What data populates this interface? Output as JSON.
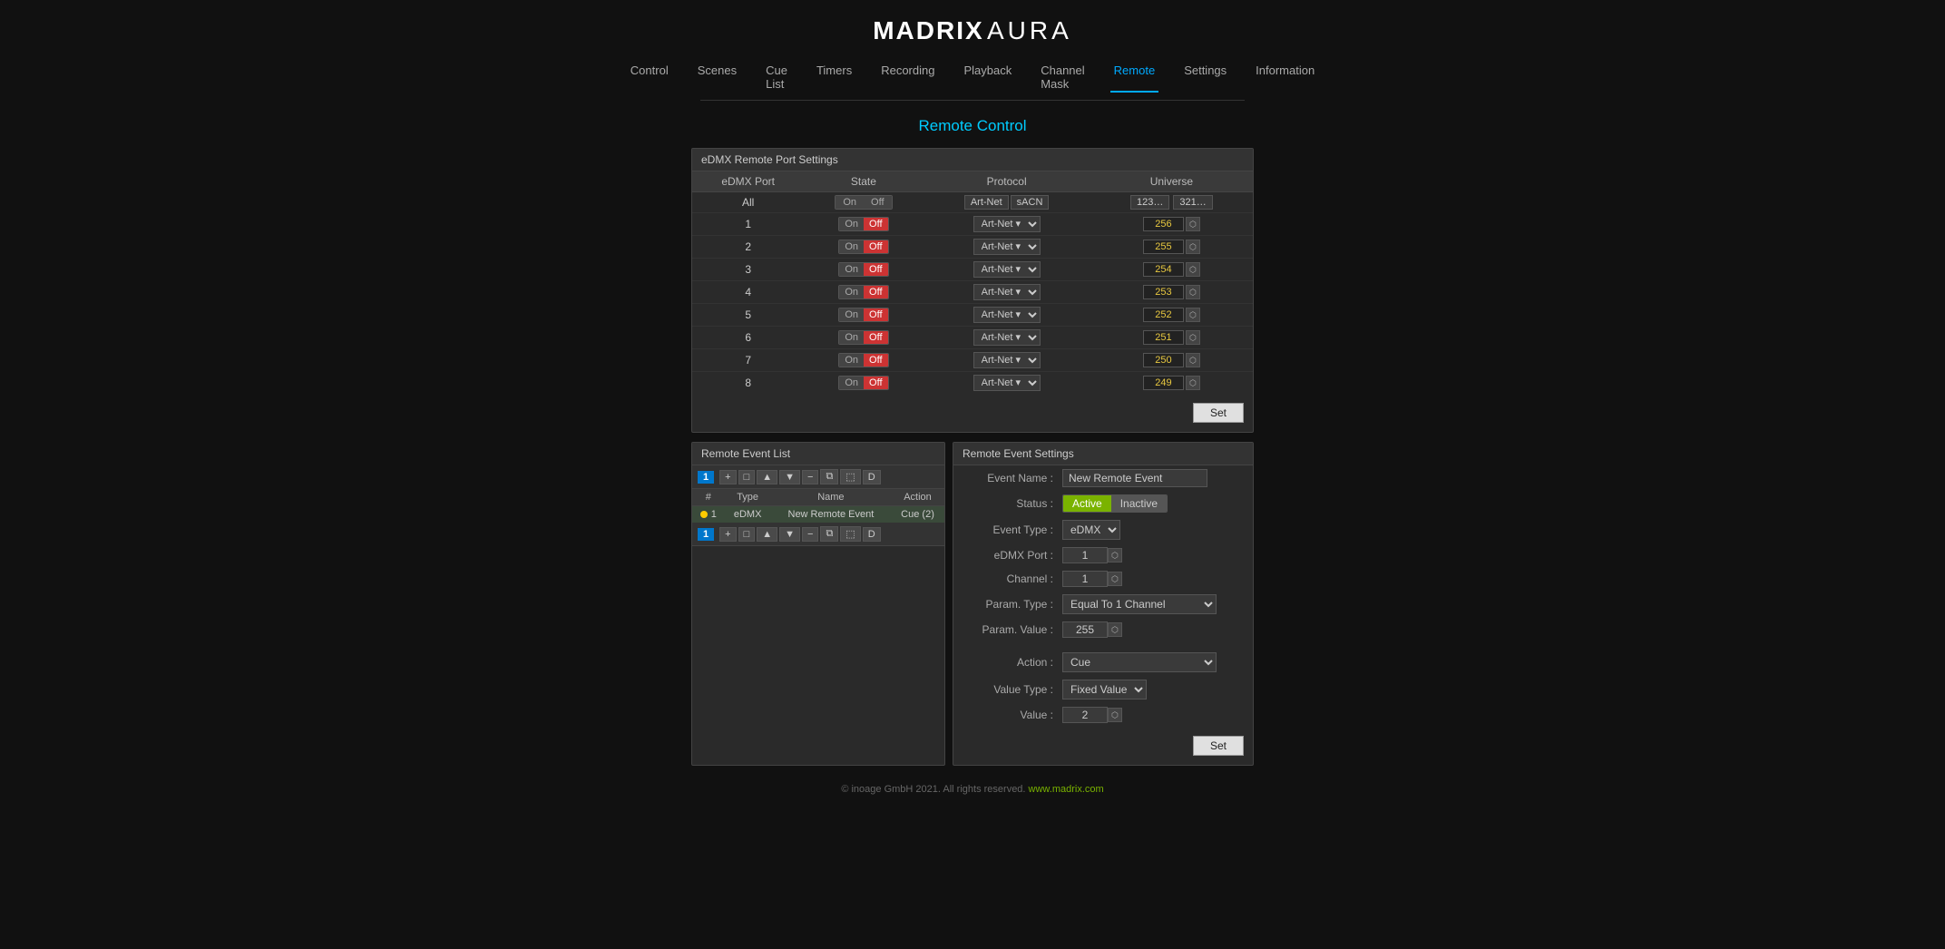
{
  "app": {
    "logo_bold": "MADRIX",
    "logo_light": "AURA",
    "footer_text": "© inoage GmbH 2021. All rights reserved.",
    "footer_link": "www.madrix.com"
  },
  "nav": {
    "items": [
      {
        "label": "Control",
        "active": false
      },
      {
        "label": "Scenes",
        "active": false
      },
      {
        "label": "Cue List",
        "active": false
      },
      {
        "label": "Timers",
        "active": false
      },
      {
        "label": "Recording",
        "active": false
      },
      {
        "label": "Playback",
        "active": false
      },
      {
        "label": "Channel Mask",
        "active": false
      },
      {
        "label": "Remote",
        "active": true
      },
      {
        "label": "Settings",
        "active": false
      },
      {
        "label": "Information",
        "active": false
      }
    ]
  },
  "page_title": "Remote Control",
  "edMXSection": {
    "title": "eDMX Remote Port Settings",
    "columns": [
      "eDMX Port",
      "State",
      "Protocol",
      "Universe"
    ],
    "all_row": {
      "port": "All",
      "on_label": "On",
      "off_label": "Off",
      "proto1": "Art-Net",
      "proto2": "sACN",
      "univ1": "123…",
      "univ2": "321…"
    },
    "rows": [
      {
        "port": "1",
        "state": "off",
        "protocol": "Art-Net",
        "universe": "256"
      },
      {
        "port": "2",
        "state": "off",
        "protocol": "Art-Net",
        "universe": "255"
      },
      {
        "port": "3",
        "state": "off",
        "protocol": "Art-Net",
        "universe": "254"
      },
      {
        "port": "4",
        "state": "off",
        "protocol": "Art-Net",
        "universe": "253"
      },
      {
        "port": "5",
        "state": "off",
        "protocol": "Art-Net",
        "universe": "252"
      },
      {
        "port": "6",
        "state": "off",
        "protocol": "Art-Net",
        "universe": "251"
      },
      {
        "port": "7",
        "state": "off",
        "protocol": "Art-Net",
        "universe": "250"
      },
      {
        "port": "8",
        "state": "off",
        "protocol": "Art-Net",
        "universe": "249"
      }
    ],
    "set_label": "Set"
  },
  "eventList": {
    "title": "Remote Event List",
    "page_num": "1",
    "columns": [
      "#",
      "Type",
      "Name",
      "Action"
    ],
    "rows": [
      {
        "num": "1",
        "dot": "yellow",
        "type": "eDMX",
        "name": "New Remote Event",
        "action": "Cue (2)"
      }
    ],
    "toolbar_icons": [
      "+",
      "□",
      "▲",
      "▼",
      "−",
      "⧉",
      "⬚",
      "D"
    ],
    "page_num2": "1",
    "toolbar2_icons": [
      "+",
      "□",
      "▲",
      "▼",
      "−",
      "⧉",
      "⬚",
      "D"
    ]
  },
  "eventSettings": {
    "title": "Remote Event Settings",
    "fields": {
      "event_name_label": "Event Name :",
      "event_name_value": "New Remote Event",
      "status_label": "Status :",
      "status_active": "Active",
      "status_inactive": "Inactive",
      "event_type_label": "Event Type :",
      "event_type_value": "eDMX",
      "edMX_port_label": "eDMX Port :",
      "edMX_port_value": "1",
      "channel_label": "Channel :",
      "channel_value": "1",
      "param_type_label": "Param. Type :",
      "param_type_value": "Equal To 1 Channel",
      "param_value_label": "Param. Value :",
      "param_value": "255",
      "action_label": "Action :",
      "action_value": "Cue",
      "value_type_label": "Value Type :",
      "value_type_value": "Fixed Value",
      "value_label": "Value :",
      "value_value": "2"
    },
    "set_label": "Set"
  }
}
